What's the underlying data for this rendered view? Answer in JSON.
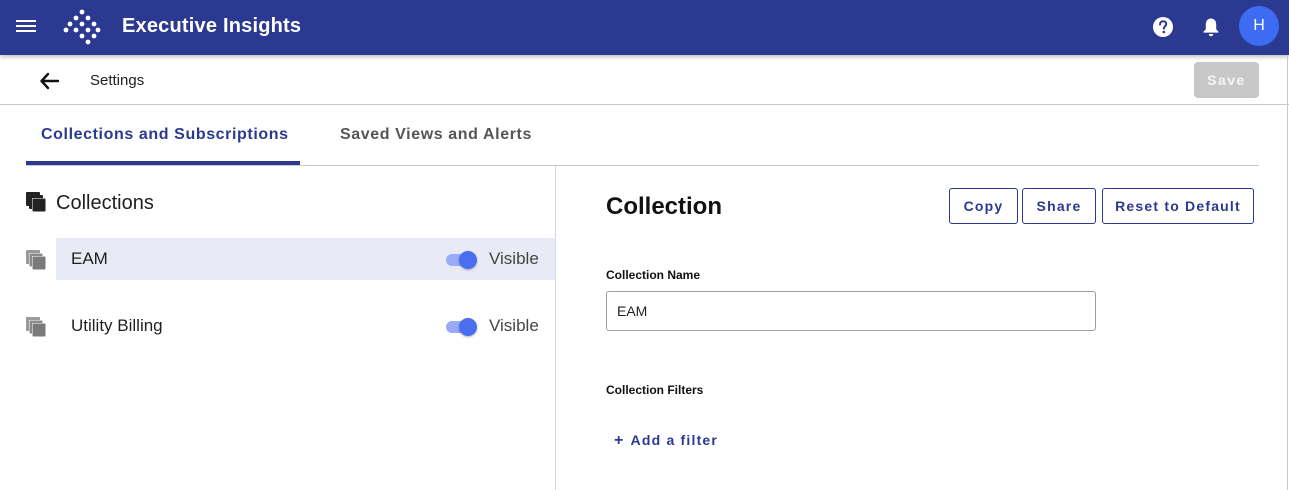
{
  "app": {
    "title": "Executive Insights",
    "avatar_initial": "H",
    "brand_color": "#2b3990"
  },
  "icons": {
    "menu": "menu-icon",
    "logo": "diamond-dots-logo",
    "help": "help-circle-icon",
    "notifications": "bell-icon",
    "back": "arrow-left-icon",
    "collections": "stacked-squares-icon"
  },
  "settings": {
    "title": "Settings",
    "save_label": "Save"
  },
  "tabs": [
    {
      "label": "Collections and Subscriptions",
      "active": true
    },
    {
      "label": "Saved Views and Alerts",
      "active": false
    }
  ],
  "left_panel": {
    "header": "Collections",
    "items": [
      {
        "name": "EAM",
        "toggle_label": "Visible",
        "visible": true,
        "selected": true
      },
      {
        "name": "Utility Billing",
        "toggle_label": "Visible",
        "visible": true,
        "selected": false
      }
    ]
  },
  "detail": {
    "title": "Collection",
    "buttons": {
      "copy": "Copy",
      "share": "Share",
      "reset": "Reset to Default"
    },
    "name_label": "Collection Name",
    "name_value": "EAM",
    "filters_label": "Collection Filters",
    "add_filter_label": "Add a filter",
    "add_filter_symbol": "+"
  }
}
